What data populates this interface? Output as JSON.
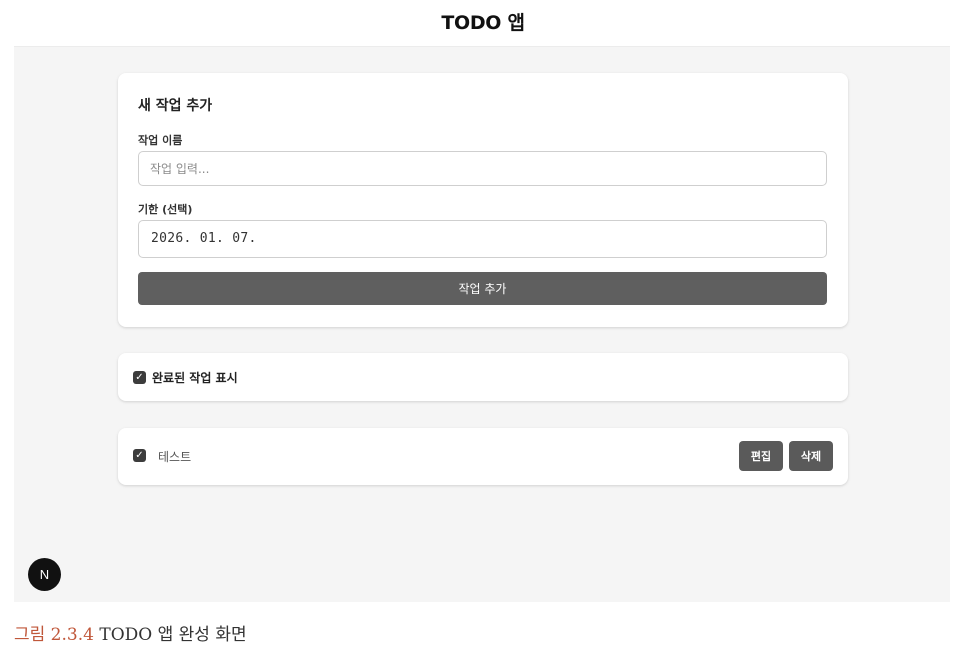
{
  "app": {
    "title": "TODO 앱"
  },
  "form": {
    "heading": "새 작업 추가",
    "name_label": "작업 이름",
    "name_placeholder": "작업 입력...",
    "name_value": "",
    "due_label": "기한 (선택)",
    "due_value": "2026. 01. 07.",
    "submit_label": "작업 추가"
  },
  "filter": {
    "show_completed_label": "완료된 작업 표시",
    "checked": true
  },
  "todos": [
    {
      "text": "테스트",
      "completed": true,
      "edit_label": "편집",
      "delete_label": "삭제"
    }
  ],
  "badge": {
    "letter": "N"
  },
  "caption": {
    "number": "그림 2.3.4",
    "text": " TODO 앱 완성 화면"
  },
  "colors": {
    "primary_button": "#5f5f5f",
    "background": "#f5f5f5",
    "caption_accent": "#c0573a"
  }
}
